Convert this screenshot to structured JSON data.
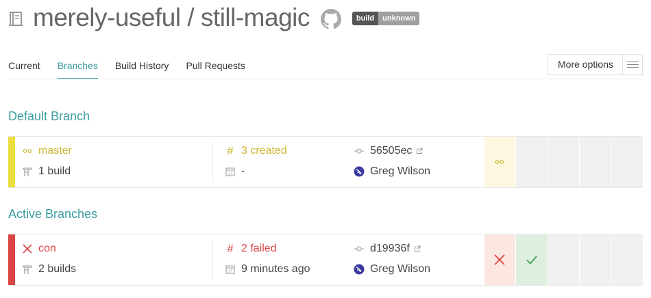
{
  "header": {
    "repo_title": "merely-useful / still-magic",
    "badge_left": "build",
    "badge_right": "unknown"
  },
  "tabs": [
    {
      "label": "Current",
      "active": false
    },
    {
      "label": "Branches",
      "active": true
    },
    {
      "label": "Build History",
      "active": false
    },
    {
      "label": "Pull Requests",
      "active": false
    }
  ],
  "more_options": {
    "label": "More options"
  },
  "sections": {
    "default": "Default Branch",
    "active": "Active Branches"
  },
  "default_branch": {
    "status": "created",
    "name": "master",
    "build_count": "1 build",
    "build_number_text": "3 created",
    "date": "-",
    "commit": "56505ec",
    "author": "Greg Wilson",
    "colors": {
      "stripe": "#edde3f",
      "text": "#cdb62c",
      "cell": "#fcf8e0"
    }
  },
  "active_branches": [
    {
      "status": "failed",
      "name": "con",
      "build_count": "2 builds",
      "build_number_text": "2 failed",
      "date": "9 minutes ago",
      "commit": "d19936f",
      "author": "Greg Wilson",
      "history": [
        "failed",
        "passed"
      ],
      "colors": {
        "stripe": "#db4545",
        "text": "#db4545",
        "cell_failed": "#fce6e2",
        "cell_passed": "#deeedf"
      }
    }
  ]
}
